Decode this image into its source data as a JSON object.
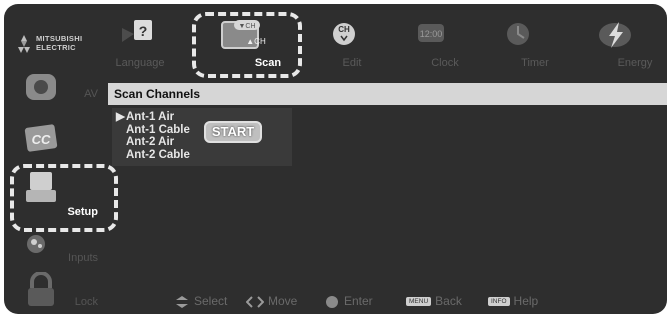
{
  "brand": {
    "line1": "MITSUBISHI",
    "line2": "ELECTRIC"
  },
  "top_menu": [
    {
      "label": "Language",
      "icon": "language-icon"
    },
    {
      "label": "Scan",
      "icon": "scan-icon",
      "active": true
    },
    {
      "label": "Edit",
      "icon": "channel-edit-icon"
    },
    {
      "label": "Clock",
      "icon": "clock-icon"
    },
    {
      "label": "Timer",
      "icon": "timer-icon"
    },
    {
      "label": "Energy",
      "icon": "energy-icon"
    }
  ],
  "sidebar": [
    {
      "label": "AV",
      "icon": "av-icon"
    },
    {
      "label": "",
      "icon": "cc-icon"
    },
    {
      "label": "Setup",
      "icon": "setup-icon",
      "active": true
    },
    {
      "label": "Inputs",
      "icon": "inputs-icon"
    },
    {
      "label": "Lock",
      "icon": "lock-icon"
    }
  ],
  "panel": {
    "title": "Scan Channels",
    "items": [
      "Ant-1 Air",
      "Ant-1 Cable",
      "Ant-2 Air",
      "Ant-2 Cable"
    ],
    "selected_index": 0,
    "start_label": "START"
  },
  "footer": {
    "select": "Select",
    "move": "Move",
    "enter": "Enter",
    "back_key": "MENU",
    "back": "Back",
    "help_key": "INFO",
    "help": "Help"
  }
}
